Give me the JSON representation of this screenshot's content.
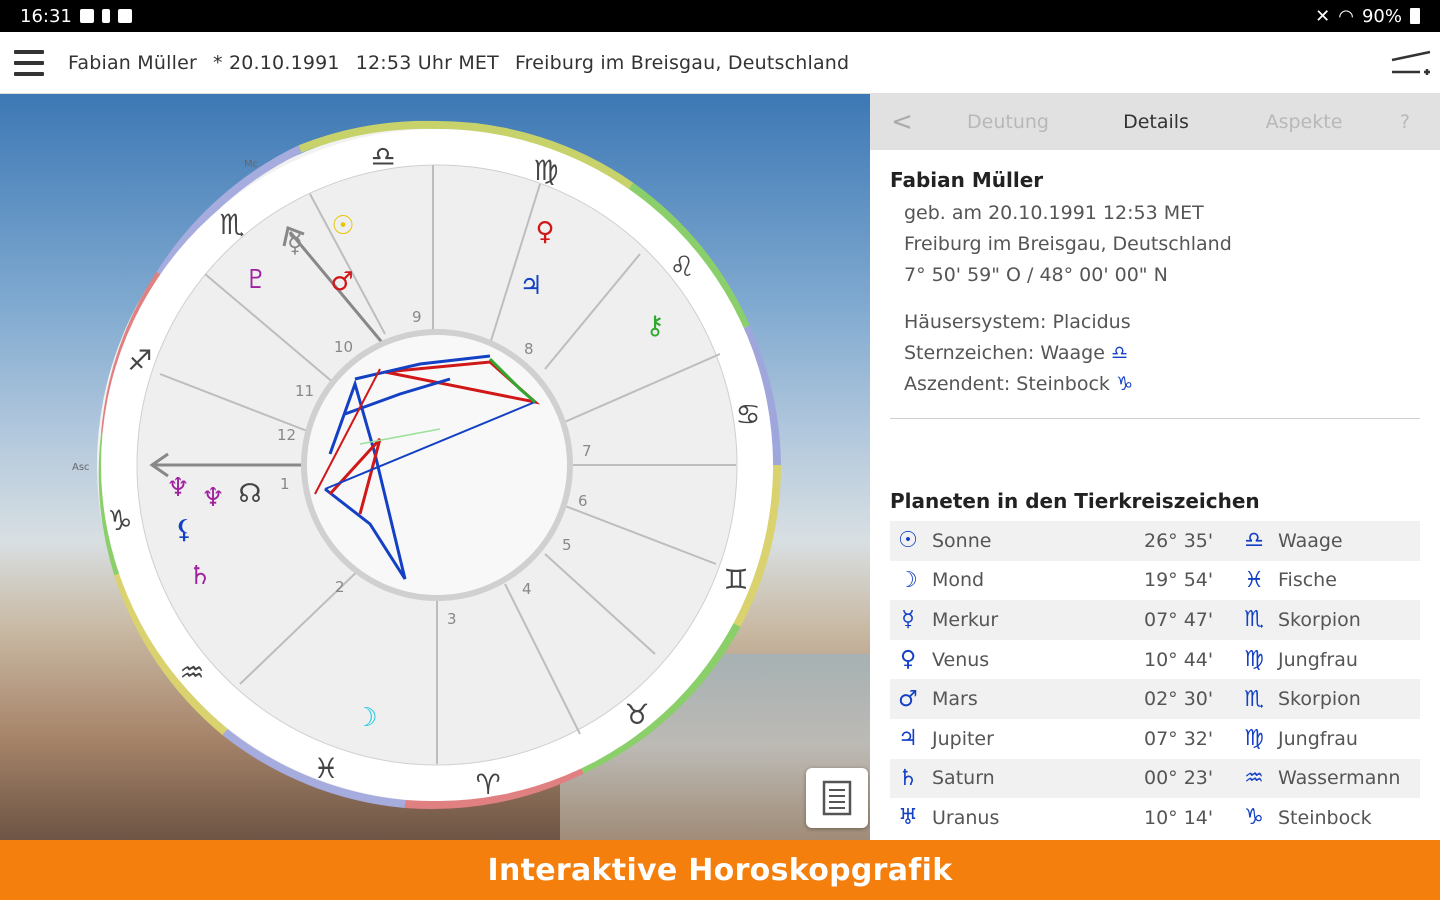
{
  "status": {
    "time": "16:31",
    "battery": "90%"
  },
  "header": {
    "name": "Fabian Müller",
    "birth_date": "* 20.10.1991",
    "birth_time": "12:53 Uhr MET",
    "place": "Freiburg im Breisgau,  Deutschland"
  },
  "chart": {
    "mc_label": "Mc",
    "asc_label": "Asc",
    "houses": [
      "1",
      "2",
      "3",
      "4",
      "5",
      "6",
      "7",
      "8",
      "9",
      "10",
      "11",
      "12"
    ]
  },
  "tabs": {
    "back": "<",
    "deutung": "Deutung",
    "details": "Details",
    "aspekte": "Aspekte",
    "help": "?"
  },
  "details": {
    "name": "Fabian Müller",
    "born": "geb. am 20.10.1991 12:53 MET",
    "place": "Freiburg im Breisgau, Deutschland",
    "coords": "7° 50' 59\" O / 48° 00' 00\" N",
    "house_system": "Häusersystem: Placidus",
    "sun_sign": "Sternzeichen: Waage",
    "sun_sign_symbol": "♎",
    "ascendant": "Aszendent: Steinbock",
    "ascendant_symbol": "♑"
  },
  "planets_title": "Planeten in den Tierkreiszeichen",
  "planets": [
    {
      "glyph": "☉",
      "name": "Sonne",
      "deg": "26° 35'",
      "sign_glyph": "♎",
      "sign": "Waage"
    },
    {
      "glyph": "☽",
      "name": "Mond",
      "deg": "19° 54'",
      "sign_glyph": "♓",
      "sign": "Fische"
    },
    {
      "glyph": "☿",
      "name": "Merkur",
      "deg": "07° 47'",
      "sign_glyph": "♏",
      "sign": "Skorpion"
    },
    {
      "glyph": "♀",
      "name": "Venus",
      "deg": "10° 44'",
      "sign_glyph": "♍",
      "sign": "Jungfrau"
    },
    {
      "glyph": "♂",
      "name": "Mars",
      "deg": "02° 30'",
      "sign_glyph": "♏",
      "sign": "Skorpion"
    },
    {
      "glyph": "♃",
      "name": "Jupiter",
      "deg": "07° 32'",
      "sign_glyph": "♍",
      "sign": "Jungfrau"
    },
    {
      "glyph": "♄",
      "name": "Saturn",
      "deg": "00° 23'",
      "sign_glyph": "♒",
      "sign": "Wassermann"
    },
    {
      "glyph": "♅",
      "name": "Uranus",
      "deg": "10° 14'",
      "sign_glyph": "♑",
      "sign": "Steinbock"
    }
  ],
  "banner": "Interaktive Horoskopgrafik",
  "colors": {
    "accent": "#f47f0d",
    "glyph": "#1340c4"
  }
}
